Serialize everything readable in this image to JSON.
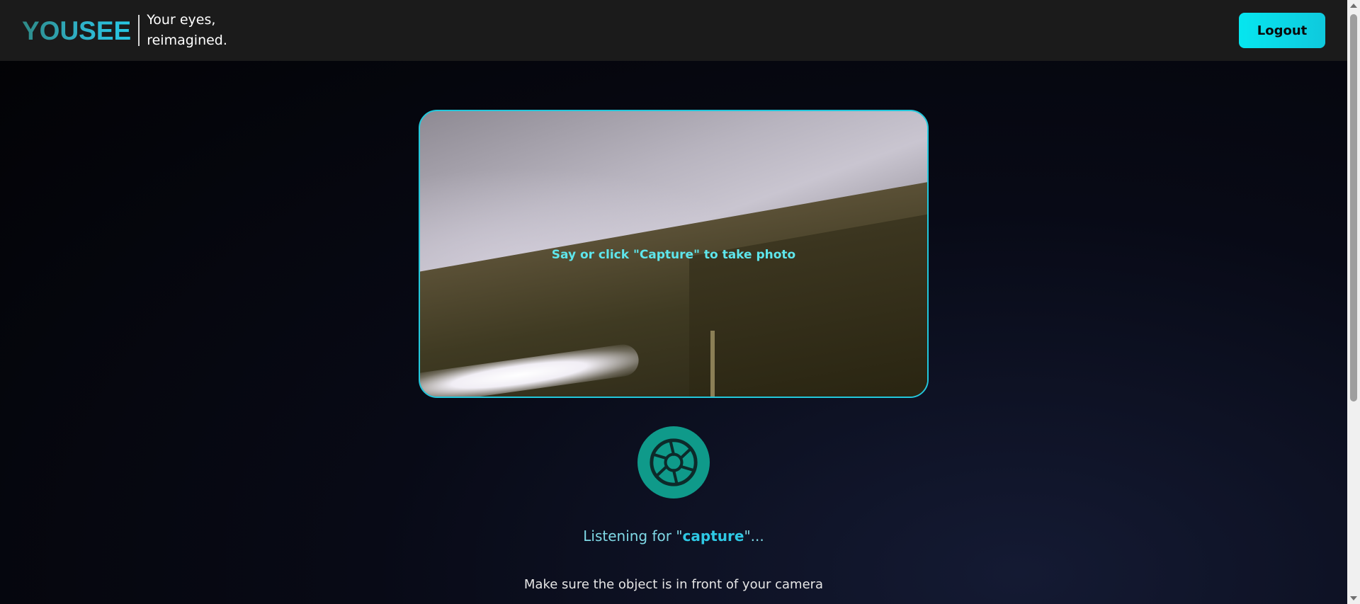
{
  "header": {
    "logo": "YOUSEE",
    "tagline": "Your eyes, reimagined.",
    "logout_label": "Logout"
  },
  "camera": {
    "prompt": "Say or click \"Capture\" to take photo"
  },
  "capture_button": {
    "icon": "aperture-icon"
  },
  "status": {
    "prefix": "Listening for \"",
    "keyword": "capture",
    "suffix": "\"..."
  },
  "hint": "Make sure the object is in front of your camera",
  "colors": {
    "accent": "#22c8dc",
    "logout_button": "#06e6ef",
    "capture_button": "#0f9a8a",
    "navbar": "#1b1b1b"
  }
}
